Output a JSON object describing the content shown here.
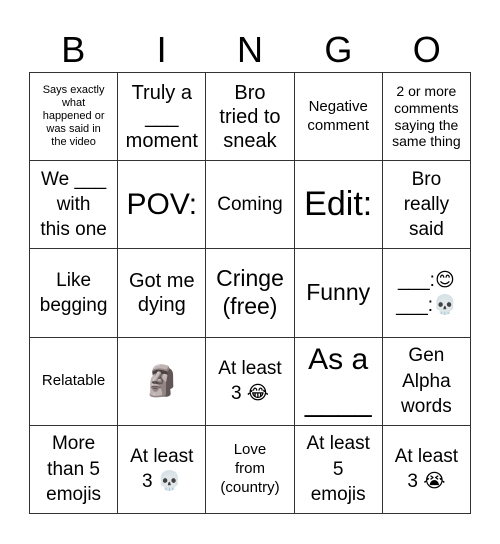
{
  "header": {
    "letters": [
      "B",
      "I",
      "N",
      "G",
      "O"
    ]
  },
  "cells": [
    {
      "text": "Says exactly\nwhat\nhappened or\nwas said in\nthe video",
      "icon": null
    },
    {
      "text": "Truly a\n___\nmoment",
      "icon": null
    },
    {
      "text": "Bro\ntried to\nsneak",
      "icon": null
    },
    {
      "text": "Negative\ncomment",
      "icon": null
    },
    {
      "text": "2 or more\ncomments\nsaying the\nsame thing",
      "icon": null
    },
    {
      "text": "We ___\nwith\nthis one",
      "icon": null
    },
    {
      "text": "POV:",
      "icon": null
    },
    {
      "text": "Coming",
      "icon": null
    },
    {
      "text": "Edit:",
      "icon": null
    },
    {
      "text": "Bro\nreally\nsaid",
      "icon": null
    },
    {
      "text": "Like\nbegging",
      "icon": null
    },
    {
      "text": "Got me\ndying",
      "icon": null
    },
    {
      "text": "Cringe\n(free)",
      "icon": null
    },
    {
      "text": "Funny",
      "icon": null
    },
    {
      "text": "___:😊\n___:💀",
      "icon": "smiling-face-and-skull-icons"
    },
    {
      "text": "Relatable",
      "icon": null
    },
    {
      "text": "🗿",
      "icon": "moai-icon"
    },
    {
      "text": "At least\n3 😂",
      "icon": "tears-of-joy-icon"
    },
    {
      "text": "As a\n____",
      "icon": null
    },
    {
      "text": "Gen\nAlpha\nwords",
      "icon": null
    },
    {
      "text": "More\nthan 5\nemojis",
      "icon": null
    },
    {
      "text": "At least\n3 💀",
      "icon": "skull-icon"
    },
    {
      "text": "Love\nfrom\n(country)",
      "icon": null
    },
    {
      "text": "At least\n5\nemojis",
      "icon": null
    },
    {
      "text": "At least\n3 😭",
      "icon": "loudly-crying-icon"
    }
  ]
}
